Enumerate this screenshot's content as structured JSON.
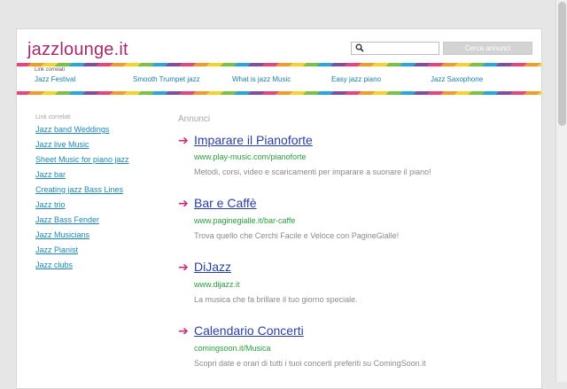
{
  "header": {
    "logo": "jazzlounge.it",
    "search": {
      "placeholder": "",
      "value": "",
      "button_label": "Cerca annunci"
    }
  },
  "nav": {
    "label": "Link correlati",
    "items": [
      "Jazz Festival",
      "Smooth Trumpet jazz",
      "What is jazz Music",
      "Easy jazz piano",
      "Jazz Saxophone"
    ]
  },
  "sidebar": {
    "title": "Link correlati",
    "links": [
      "Jazz band Weddings",
      "Jazz live Music",
      "Sheet Music for piano jazz",
      "Jazz bar",
      "Creating jazz Bass Lines",
      "Jazz trio",
      "Jazz Bass Fender",
      "Jazz Musicians",
      "Jazz Pianist",
      "Jazz clubs"
    ]
  },
  "ads": {
    "title": "Annunci",
    "arrow": "➔",
    "items": [
      {
        "title": "Imparare il Pianoforte",
        "url": "www.play-music.com/pianoforte",
        "desc": "Metodi, corsi, video e scaricamenti per imparare a suonare il piano!"
      },
      {
        "title": "Bar e Caffè",
        "url": "www.paginegialle.it/bar-caffe",
        "desc": "Trova quello che Cerchi Facile e Veloce con PagineGialle!"
      },
      {
        "title": "DiJazz",
        "url": "www.dijazz.it",
        "desc": "La musica che fa brillare il tuo giorno speciale."
      },
      {
        "title": "Calendario Concerti",
        "url": "comingsoon.it/Musica",
        "desc": "Scopri date e orari di tutti i tuoi concerti preferiti su ComingSoon.it"
      }
    ]
  },
  "colors": {
    "logo": "#a8296f",
    "link": "#1a8ab6",
    "ad_title": "#2a3ea6",
    "ad_url": "#27a13a",
    "arrow": "#d12a74"
  }
}
